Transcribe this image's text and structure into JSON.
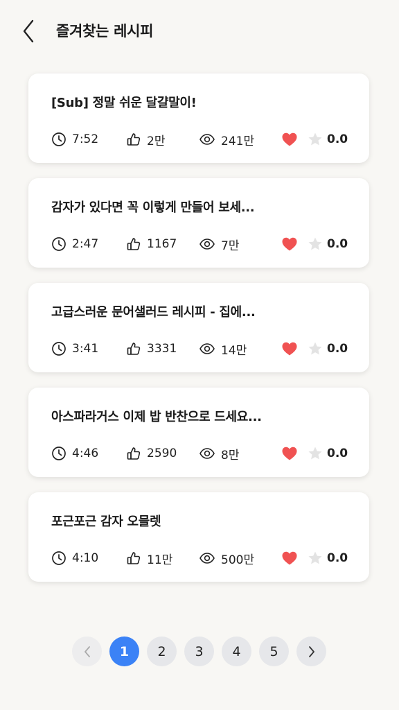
{
  "header": {
    "title": "즐겨찾는 레시피",
    "back_icon": "chevron-left-icon"
  },
  "recipes": [
    {
      "title": "[Sub] 정말 쉬운 달걀말이!",
      "time": "7:52",
      "likes": "2만",
      "views": "241만",
      "rating": "0.0",
      "favorited": true
    },
    {
      "title": "감자가 있다면 꼭 이렇게 만들어 보세...",
      "time": "2:47",
      "likes": "1167",
      "views": "7만",
      "rating": "0.0",
      "favorited": true
    },
    {
      "title": "고급스러운 문어샐러드 레시피 - 집에...",
      "time": "3:41",
      "likes": "3331",
      "views": "14만",
      "rating": "0.0",
      "favorited": true
    },
    {
      "title": "아스파라거스 이제 밥 반찬으로 드세요...",
      "time": "4:46",
      "likes": "2590",
      "views": "8만",
      "rating": "0.0",
      "favorited": true
    },
    {
      "title": "포근포근 감자 오믈렛",
      "time": "4:10",
      "likes": "11만",
      "views": "500만",
      "rating": "0.0",
      "favorited": true
    }
  ],
  "pagination": {
    "pages": [
      "1",
      "2",
      "3",
      "4",
      "5"
    ],
    "current": "1",
    "prev_icon": "chevron-left-icon",
    "next_icon": "chevron-right-icon"
  },
  "colors": {
    "background": "#f8f7f4",
    "accent": "#3b82f6",
    "heart": "#f05252",
    "star": "#e3e3e3"
  }
}
